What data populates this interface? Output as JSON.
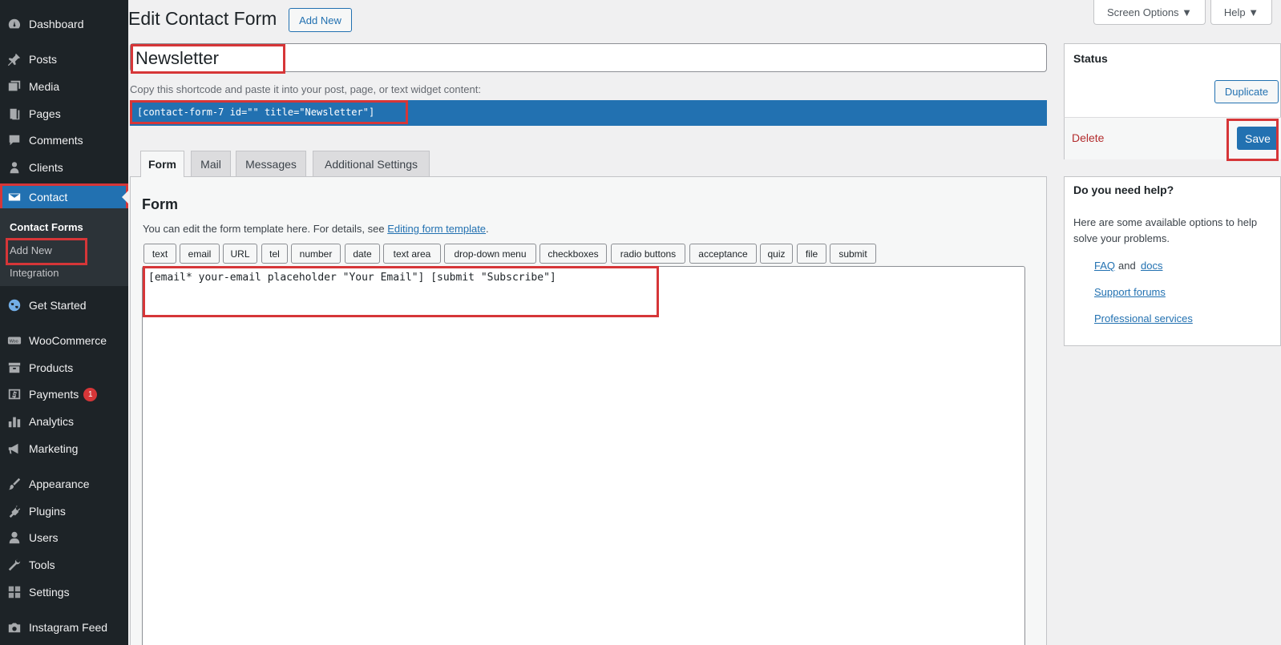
{
  "sidebar": {
    "items": [
      {
        "label": "Dashboard",
        "icon": "dashboard-icon"
      },
      {
        "label": "Posts",
        "icon": "pin-icon"
      },
      {
        "label": "Media",
        "icon": "media-icon"
      },
      {
        "label": "Pages",
        "icon": "pages-icon"
      },
      {
        "label": "Comments",
        "icon": "comments-icon"
      },
      {
        "label": "Clients",
        "icon": "clients-icon"
      },
      {
        "label": "Contact",
        "icon": "envelope-icon"
      },
      {
        "label": "Get Started",
        "icon": "globe-icon"
      },
      {
        "label": "WooCommerce",
        "icon": "woo-icon"
      },
      {
        "label": "Products",
        "icon": "archive-icon"
      },
      {
        "label": "Payments",
        "icon": "dollar-icon",
        "badge": "1"
      },
      {
        "label": "Analytics",
        "icon": "bar-chart-icon"
      },
      {
        "label": "Marketing",
        "icon": "megaphone-icon"
      },
      {
        "label": "Appearance",
        "icon": "brush-icon"
      },
      {
        "label": "Plugins",
        "icon": "plug-icon"
      },
      {
        "label": "Users",
        "icon": "user-icon"
      },
      {
        "label": "Tools",
        "icon": "wrench-icon"
      },
      {
        "label": "Settings",
        "icon": "settings-icon"
      },
      {
        "label": "Instagram Feed",
        "icon": "camera-icon"
      }
    ],
    "submenu": {
      "contact_forms": "Contact Forms",
      "add_new": "Add New",
      "integration": "Integration"
    }
  },
  "header": {
    "title": "Edit Contact Form",
    "add_new": "Add New",
    "screen_options": "Screen Options ▼",
    "help": "Help ▼"
  },
  "form_title": {
    "value": "Newsletter"
  },
  "shortcode": {
    "hint": "Copy this shortcode and paste it into your post, page, or text widget content:",
    "value": "[contact-form-7 id=\"\" title=\"Newsletter\"]"
  },
  "tabs": [
    "Form",
    "Mail",
    "Messages",
    "Additional Settings"
  ],
  "form_panel": {
    "heading": "Form",
    "desc_prefix": "You can edit the form template here. For details, see ",
    "desc_link": "Editing form template",
    "desc_suffix": ".",
    "tag_buttons": [
      "text",
      "email",
      "URL",
      "tel",
      "number",
      "date",
      "text area",
      "drop-down menu",
      "checkboxes",
      "radio buttons",
      "acceptance",
      "quiz",
      "file",
      "submit"
    ],
    "template": "[email* your-email placeholder \"Your Email\"] [submit \"Subscribe\"]"
  },
  "status_box": {
    "title": "Status",
    "duplicate": "Duplicate",
    "delete": "Delete",
    "save": "Save"
  },
  "help_box": {
    "title": "Do you need help?",
    "text": "Here are some available options to help solve your problems.",
    "faq": "FAQ",
    "and": "and",
    "docs": "docs",
    "support": "Support forums",
    "professional": "Professional services"
  },
  "colors": {
    "accent": "#2271b1",
    "sidebar": "#1d2327",
    "highlight": "#d63638"
  }
}
